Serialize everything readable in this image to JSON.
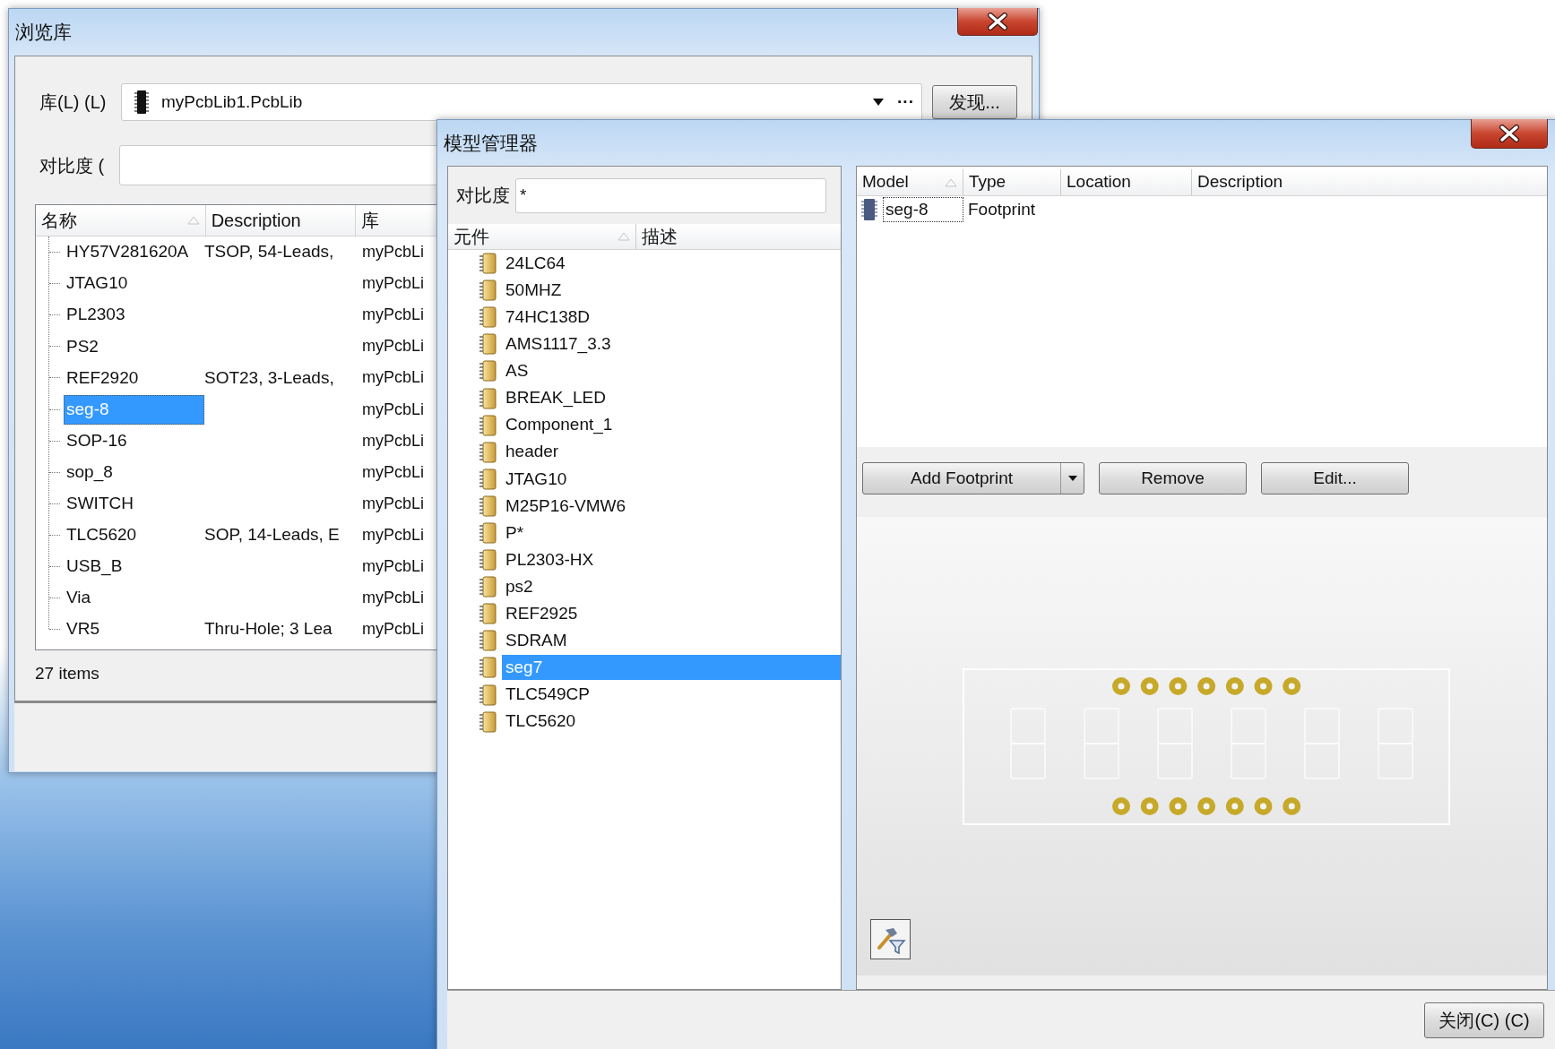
{
  "browse_window": {
    "title": "浏览库",
    "library": {
      "label": "库(L) (L)",
      "value": "myPcbLib1.PcbLib",
      "browse": "···"
    },
    "find_button": "发现...",
    "filter": {
      "label": "对比度 ("
    },
    "columns": [
      {
        "label": "名称",
        "sorted": true
      },
      {
        "label": "Description",
        "sorted": false
      },
      {
        "label": "库",
        "sorted": false
      }
    ],
    "rows": [
      {
        "name": "HY57V281620A",
        "description": "TSOP, 54-Leads,",
        "library": "myPcbLi",
        "selected": false
      },
      {
        "name": "JTAG10",
        "library": "myPcbLi",
        "selected": false
      },
      {
        "name": "PL2303",
        "library": "myPcbLi",
        "selected": false
      },
      {
        "name": "PS2",
        "library": "myPcbLi",
        "selected": false
      },
      {
        "name": "REF2920",
        "description": "SOT23, 3-Leads,",
        "library": "myPcbLi",
        "selected": false
      },
      {
        "name": "seg-8",
        "library": "myPcbLi",
        "selected": true
      },
      {
        "name": "SOP-16",
        "library": "myPcbLi",
        "selected": false
      },
      {
        "name": "sop_8",
        "library": "myPcbLi",
        "selected": false
      },
      {
        "name": "SWITCH",
        "library": "myPcbLi",
        "selected": false
      },
      {
        "name": "TLC5620",
        "description": "SOP, 14-Leads, E",
        "library": "myPcbLi",
        "selected": false
      },
      {
        "name": "USB_B",
        "library": "myPcbLi",
        "selected": false
      },
      {
        "name": "Via",
        "library": "myPcbLi",
        "selected": false
      },
      {
        "name": "VR5",
        "description": "Thru-Hole; 3 Lea",
        "library": "myPcbLi",
        "selected": false
      }
    ],
    "status": "27 items"
  },
  "model_window": {
    "title": "模型管理器",
    "filter": {
      "label": "对比度",
      "value": "*"
    },
    "columns": [
      {
        "label": "元件",
        "sorted": true
      },
      {
        "label": "描述",
        "sorted": false
      }
    ],
    "components": [
      {
        "name": "24LC64",
        "selected": false
      },
      {
        "name": "50MHZ",
        "selected": false
      },
      {
        "name": "74HC138D",
        "selected": false
      },
      {
        "name": "AMS1117_3.3",
        "selected": false
      },
      {
        "name": "AS",
        "selected": false
      },
      {
        "name": "BREAK_LED",
        "selected": false
      },
      {
        "name": "Component_1",
        "selected": false
      },
      {
        "name": "header",
        "selected": false
      },
      {
        "name": "JTAG10",
        "selected": false
      },
      {
        "name": "M25P16-VMW6",
        "selected": false
      },
      {
        "name": "P*",
        "selected": false
      },
      {
        "name": "PL2303-HX",
        "selected": false
      },
      {
        "name": "ps2",
        "selected": false
      },
      {
        "name": "REF2925",
        "selected": false
      },
      {
        "name": "SDRAM",
        "selected": false
      },
      {
        "name": "seg7",
        "selected": true
      },
      {
        "name": "TLC549CP",
        "selected": false
      },
      {
        "name": "TLC5620",
        "selected": false
      }
    ],
    "model_columns": [
      {
        "label": "Model",
        "sorted": true
      },
      {
        "label": "Type",
        "sorted": false
      },
      {
        "label": "Location",
        "sorted": false
      },
      {
        "label": "Description",
        "sorted": false
      }
    ],
    "models": [
      {
        "model": "seg-8",
        "type": "Footprint",
        "selected": true
      }
    ],
    "buttons": [
      {
        "label": "Add Footprint",
        "kind": "split"
      },
      {
        "label": "Remove",
        "kind": "plain"
      },
      {
        "label": "Edit...",
        "kind": "plain"
      }
    ],
    "close_button": "关闭(C) (C)"
  }
}
